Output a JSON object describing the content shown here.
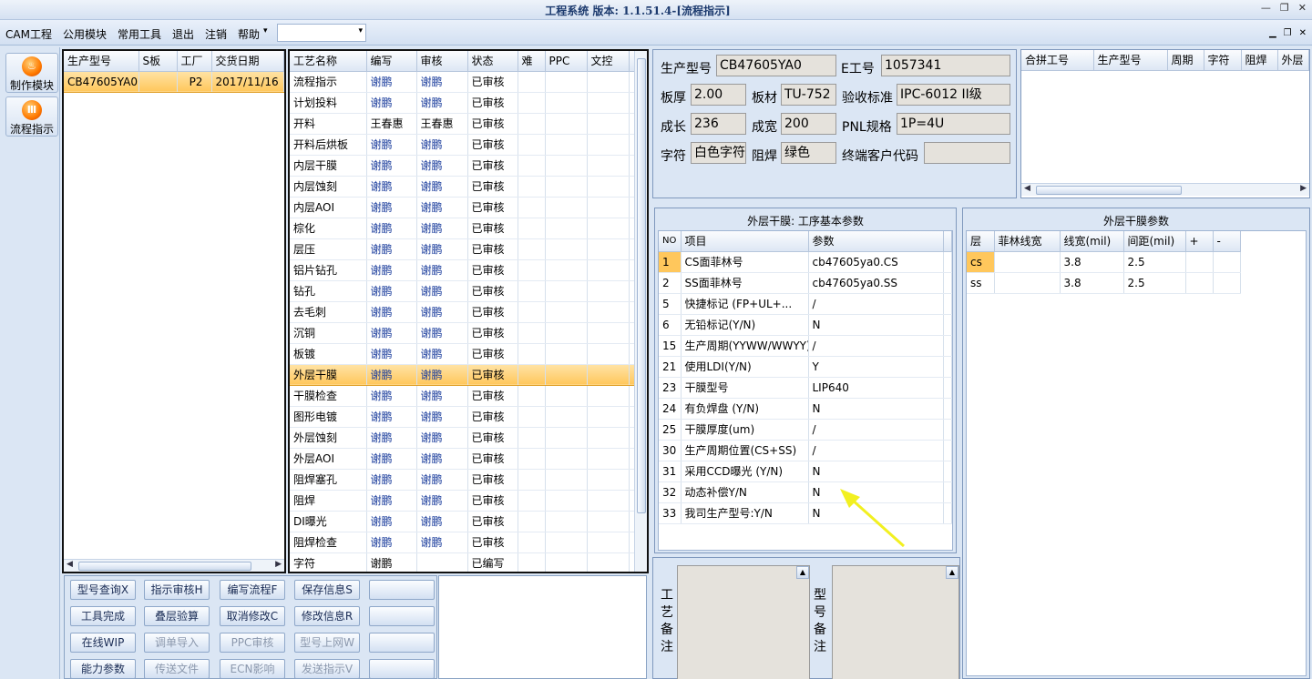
{
  "window": {
    "title": "工程系统 版本: 1.1.51.4-[流程指示]",
    "controls": [
      "—",
      "❐",
      "✕"
    ]
  },
  "menubar": {
    "items": [
      "CAM工程",
      "公用模块",
      "常用工具",
      "退出",
      "注销",
      "帮助"
    ],
    "help_dropdown": "▾",
    "combo_value": "",
    "mdi_controls": [
      "▁",
      "❐",
      "✕"
    ]
  },
  "nav": {
    "items": [
      {
        "label": "制作模块",
        "icon": "flame-icon"
      },
      {
        "label": "流程指示",
        "icon": "bars-icon"
      }
    ]
  },
  "models_table": {
    "headers": [
      "生产型号",
      "S板",
      "工厂",
      "交货日期"
    ],
    "rows": [
      [
        "CB47605YA0",
        "",
        "P2",
        "2017/11/16"
      ]
    ]
  },
  "process_table": {
    "headers": [
      "工艺名称",
      "编写",
      "审核",
      "状态",
      "难",
      "PPC",
      "文控"
    ],
    "rows": [
      [
        "流程指示",
        "谢鹏",
        "谢鹏",
        "已审核"
      ],
      [
        "计划投料",
        "谢鹏",
        "谢鹏",
        "已审核"
      ],
      [
        "开料",
        "王春惠",
        "王春惠",
        "已审核"
      ],
      [
        "开料后烘板",
        "谢鹏",
        "谢鹏",
        "已审核"
      ],
      [
        "内层干膜",
        "谢鹏",
        "谢鹏",
        "已审核"
      ],
      [
        "内层蚀刻",
        "谢鹏",
        "谢鹏",
        "已审核"
      ],
      [
        "内层AOI",
        "谢鹏",
        "谢鹏",
        "已审核"
      ],
      [
        "棕化",
        "谢鹏",
        "谢鹏",
        "已审核"
      ],
      [
        "层压",
        "谢鹏",
        "谢鹏",
        "已审核"
      ],
      [
        "铝片钻孔",
        "谢鹏",
        "谢鹏",
        "已审核"
      ],
      [
        "钻孔",
        "谢鹏",
        "谢鹏",
        "已审核"
      ],
      [
        "去毛刺",
        "谢鹏",
        "谢鹏",
        "已审核"
      ],
      [
        "沉铜",
        "谢鹏",
        "谢鹏",
        "已审核"
      ],
      [
        "板镀",
        "谢鹏",
        "谢鹏",
        "已审核"
      ],
      [
        "外层干膜",
        "谢鹏",
        "谢鹏",
        "已审核"
      ],
      [
        "干膜检查",
        "谢鹏",
        "谢鹏",
        "已审核"
      ],
      [
        "图形电镀",
        "谢鹏",
        "谢鹏",
        "已审核"
      ],
      [
        "外层蚀刻",
        "谢鹏",
        "谢鹏",
        "已审核"
      ],
      [
        "外层AOI",
        "谢鹏",
        "谢鹏",
        "已审核"
      ],
      [
        "阻焊塞孔",
        "谢鹏",
        "谢鹏",
        "已审核"
      ],
      [
        "阻焊",
        "谢鹏",
        "谢鹏",
        "已审核"
      ],
      [
        "DI曝光",
        "谢鹏",
        "谢鹏",
        "已审核"
      ],
      [
        "阻焊检查",
        "谢鹏",
        "谢鹏",
        "已审核"
      ],
      [
        "字符",
        "谢鹏",
        "",
        "已编写"
      ]
    ],
    "selected_row": "外层干膜"
  },
  "buttons": [
    {
      "label": "型号查询X",
      "enabled": true
    },
    {
      "label": "指示审核H",
      "enabled": true
    },
    {
      "label": "编写流程F",
      "enabled": true
    },
    {
      "label": "保存信息S",
      "enabled": true
    },
    {
      "label": "",
      "enabled": true
    },
    {
      "label": "工具完成",
      "enabled": true
    },
    {
      "label": "叠层验算",
      "enabled": true
    },
    {
      "label": "取消修改C",
      "enabled": true
    },
    {
      "label": "修改信息R",
      "enabled": true
    },
    {
      "label": "",
      "enabled": true
    },
    {
      "label": "在线WIP",
      "enabled": true
    },
    {
      "label": "调单导入",
      "enabled": false
    },
    {
      "label": "PPC审核",
      "enabled": false
    },
    {
      "label": "型号上网W",
      "enabled": false
    },
    {
      "label": "",
      "enabled": true
    },
    {
      "label": "能力参数",
      "enabled": true
    },
    {
      "label": "传送文件",
      "enabled": false
    },
    {
      "label": "ECN影响",
      "enabled": false
    },
    {
      "label": "发送指示V",
      "enabled": false
    },
    {
      "label": "",
      "enabled": true
    }
  ],
  "info": {
    "model_label": "生产型号",
    "model_value": "CB47605YA0",
    "eno_label": "E工号",
    "eno_value": "1057341",
    "thick_label": "板厚",
    "thick_value": "2.00",
    "material_label": "板材",
    "material_value": "TU-752",
    "std_label": "验收标准",
    "std_value": "IPC-6012 II级",
    "len_label": "成长",
    "len_value": "236",
    "wid_label": "成宽",
    "wid_value": "200",
    "pnl_label": "PNL规格",
    "pnl_value": "1P=4U",
    "char_label": "字符",
    "char_value": "白色字符",
    "mask_label": "阻焊",
    "mask_value": "绿色",
    "cust_label": "终端客户代码",
    "cust_value": ""
  },
  "merge_table": {
    "headers": [
      "合拼工号",
      "生产型号",
      "周期",
      "字符",
      "阻焊",
      "外层"
    ]
  },
  "params_group": {
    "title": "外层干膜: 工序基本参数",
    "headers": [
      "NO",
      "项目",
      "参数"
    ],
    "rows": [
      [
        "1",
        "CS面菲林号",
        "cb47605ya0.CS"
      ],
      [
        "2",
        "SS面菲林号",
        "cb47605ya0.SS"
      ],
      [
        "5",
        "快捷标记 (FP+UL+...",
        "/"
      ],
      [
        "6",
        "无铅标记(Y/N)",
        "N"
      ],
      [
        "15",
        "生产周期(YYWW/WWYY)",
        "/"
      ],
      [
        "21",
        "使用LDI(Y/N)",
        "Y"
      ],
      [
        "23",
        "干膜型号",
        "LIP640"
      ],
      [
        "24",
        "有负焊盘 (Y/N)",
        "N"
      ],
      [
        "25",
        "干膜厚度(um)",
        "/"
      ],
      [
        "30",
        "生产周期位置(CS+SS)",
        "/"
      ],
      [
        "31",
        "采用CCD曝光 (Y/N)",
        "N"
      ],
      [
        "32",
        "动态补偿Y/N",
        "N"
      ],
      [
        "33",
        "我司生产型号:Y/N",
        "N"
      ]
    ]
  },
  "film_group": {
    "title": "外层干膜参数",
    "headers": [
      "层",
      "菲林线宽",
      "线宽(mil)",
      "间距(mil)",
      "+",
      "-"
    ],
    "rows": [
      [
        "cs",
        "",
        "3.8",
        "2.5"
      ],
      [
        "ss",
        "",
        "3.8",
        "2.5"
      ]
    ]
  },
  "memo": {
    "process_label": "工艺备注",
    "model_label": "型号备注"
  },
  "colors": {
    "accent": "#ffc75c",
    "annotation_arrow": "#f2f020",
    "name_column": "#e3edf8"
  }
}
